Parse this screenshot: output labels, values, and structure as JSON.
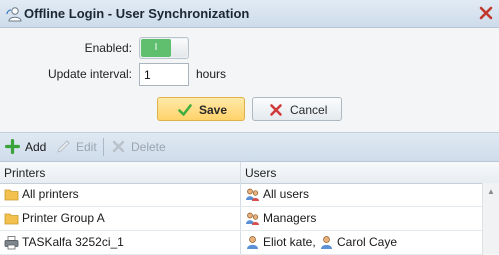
{
  "dialog": {
    "title": "Offline Login - User Synchronization"
  },
  "form": {
    "enabled_label": "Enabled:",
    "toggle_text": "I",
    "interval_label": "Update interval:",
    "interval_value": "1",
    "interval_unit": "hours"
  },
  "buttons": {
    "save": "Save",
    "cancel": "Cancel"
  },
  "toolbar": {
    "add": "Add",
    "edit": "Edit",
    "delete": "Delete"
  },
  "grid": {
    "columns": [
      "Printers",
      "Users"
    ],
    "rows": [
      {
        "printer": "All printers",
        "printer_icon": "folder-icon",
        "users": [
          "All users"
        ]
      },
      {
        "printer": "Printer Group A",
        "printer_icon": "folder-icon",
        "users": [
          "Managers"
        ]
      },
      {
        "printer": "TASKalfa 3252ci_1",
        "printer_icon": "printer-icon",
        "users": [
          "Eliot kate,",
          "Carol Caye"
        ]
      }
    ]
  },
  "colors": {
    "toggle_on": "#5fbf6e",
    "save_button": "#ffd36a",
    "titlebar": "#cddbea",
    "close": "#c0392b"
  }
}
